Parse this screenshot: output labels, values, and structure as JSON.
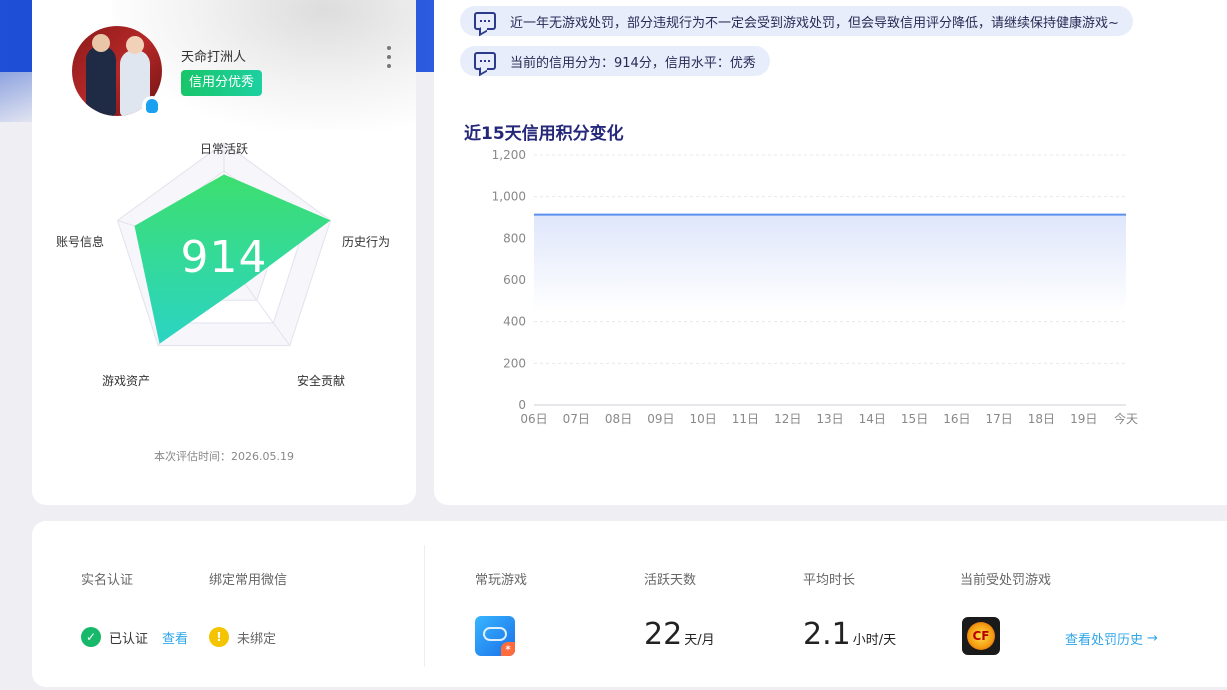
{
  "profile": {
    "nickname": "天命打洲人",
    "credit_badge": "信用分优秀",
    "score": "914",
    "eval_time": "本次评估时间：2026.05.19",
    "radar_labels": {
      "daily_active": "日常活跃",
      "history_behavior": "历史行为",
      "security_contribution": "安全贡献",
      "game_assets": "游戏资产",
      "account_info": "账号信息"
    },
    "radar_values_fraction": {
      "daily_active": 0.72,
      "history_behavior": 1.0,
      "security_contribution": 0.32,
      "game_assets": 0.98,
      "account_info": 0.84
    },
    "radar_fill_colors": [
      "#3ddf6e",
      "#2bd4c4"
    ]
  },
  "notices": [
    {
      "text": "近一年无游戏处罚，部分违规行为不一定会受到游戏处罚，但会导致信用评分降低，请继续保持健康游戏~"
    },
    {
      "text": "当前的信用分为：914分，信用水平：优秀"
    }
  ],
  "chart": {
    "title": "近15天信用积分变化"
  },
  "chart_data": {
    "type": "area",
    "title": "近15天信用积分变化",
    "xlabel": "",
    "ylabel": "",
    "categories": [
      "06日",
      "07日",
      "08日",
      "09日",
      "10日",
      "11日",
      "12日",
      "13日",
      "14日",
      "15日",
      "16日",
      "17日",
      "18日",
      "19日",
      "今天"
    ],
    "series": [
      {
        "values": [
          914,
          914,
          914,
          914,
          914,
          914,
          914,
          914,
          914,
          914,
          914,
          914,
          914,
          914,
          914
        ]
      }
    ],
    "ylim": [
      0,
      1200
    ],
    "yticks": [
      "0",
      "200",
      "400",
      "600",
      "800",
      "1,000",
      "1,200"
    ],
    "grid": true,
    "line_color": "#5b8ff0",
    "fill_color": "#dfe6fb"
  },
  "bottom": {
    "realname_label": "实名认证",
    "wechat_label": "绑定常用微信",
    "realname_status": "已认证",
    "realname_link": "查看",
    "wechat_status": "未绑定",
    "frequent_game_label": "常玩游戏",
    "active_days_label": "活跃天数",
    "active_days_value": "22",
    "active_days_unit": "天/月",
    "avg_time_label": "平均时长",
    "avg_time_value": "2.1",
    "avg_time_unit": "小时/天",
    "punished_game_label": "当前受处罚游戏",
    "history_link": "查看处罚历史"
  }
}
